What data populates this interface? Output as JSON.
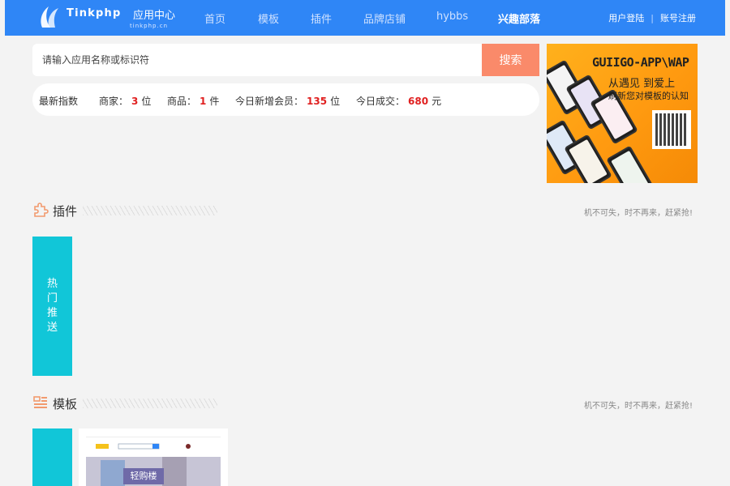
{
  "header": {
    "logo_text": "Tinkphp",
    "logo_cn": "应用中心",
    "logo_sub": "tinkphp.cn",
    "nav": [
      "首页",
      "模板",
      "插件",
      "品牌店铺",
      "hybbs",
      "兴趣部落"
    ],
    "active_nav": "兴趣部落",
    "login_label": "用户登陆",
    "separator": "|",
    "register_label": "账号注册"
  },
  "search": {
    "placeholder": "请输入应用名称或标识符",
    "button_label": "搜索"
  },
  "stats": {
    "title": "最新指数",
    "merchants_label": "商家：",
    "merchants_value": "3",
    "merchants_unit": "位",
    "products_label": "商品：",
    "products_value": "1",
    "products_unit": "件",
    "new_members_label": "今日新增会员：",
    "new_members_value": "135",
    "new_members_unit": "位",
    "deals_label": "今日成交：",
    "deals_value": "680",
    "deals_unit": "元"
  },
  "banner": {
    "title": "GUIIGO-APP\\WAP",
    "line1": "从遇见  到爱上",
    "line2": "刷新您对模板的认知"
  },
  "sections": {
    "plugins": {
      "title": "插件",
      "slogan": "机不可失，时不再来，赶紧抢!",
      "hot_tab": "热门推送"
    },
    "templates": {
      "title": "模板",
      "slogan": "机不可失，时不再来，赶紧抢!"
    }
  },
  "template_card": {
    "hero_text": "轻购楼"
  },
  "colors": {
    "header": "#2f86f6",
    "search_button": "#fa8a6a",
    "stat_number": "#e02020",
    "hot_tab": "#11c6d8",
    "section_icon": "#f29a6e",
    "banner": "#ffa414"
  }
}
